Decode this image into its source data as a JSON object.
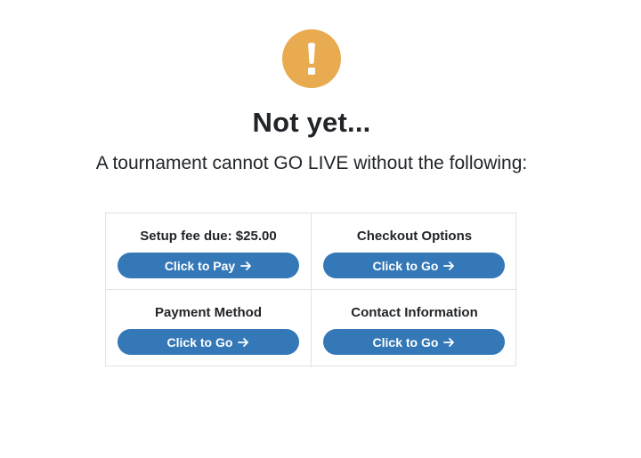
{
  "heading": {
    "icon": "exclamation-icon",
    "title": "Not yet...",
    "subtitle": "A tournament cannot GO LIVE without the following:"
  },
  "requirements": [
    {
      "label": "Setup fee due: $25.00",
      "button": "Click to Pay",
      "icon": "arrow-right-icon"
    },
    {
      "label": "Checkout Options",
      "button": "Click to Go",
      "icon": "arrow-right-icon"
    },
    {
      "label": "Payment Method",
      "button": "Click to Go",
      "icon": "arrow-right-icon"
    },
    {
      "label": "Contact Information",
      "button": "Click to Go",
      "icon": "arrow-right-icon"
    }
  ],
  "colors": {
    "warning": "#e8ab4f",
    "button": "#3478b7",
    "text": "#212529",
    "border": "#e3e3e3"
  }
}
